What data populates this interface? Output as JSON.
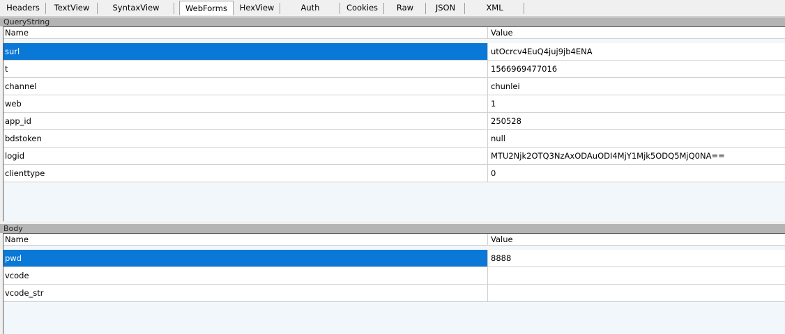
{
  "tabs": [
    {
      "label": "Headers",
      "selected": false
    },
    {
      "label": "TextView",
      "selected": false
    },
    {
      "label": "SyntaxView",
      "selected": false
    },
    {
      "label": "WebForms",
      "selected": true
    },
    {
      "label": "HexView",
      "selected": false
    },
    {
      "label": "Auth",
      "selected": false
    },
    {
      "label": "Cookies",
      "selected": false
    },
    {
      "label": "Raw",
      "selected": false
    },
    {
      "label": "JSON",
      "selected": false
    },
    {
      "label": "XML",
      "selected": false
    }
  ],
  "querystring": {
    "title": "QueryString",
    "columns": {
      "name": "Name",
      "value": "Value"
    },
    "rows": [
      {
        "name": "surl",
        "value": "utOcrcv4EuQ4juj9jb4ENA",
        "selected": true
      },
      {
        "name": "t",
        "value": "1566969477016",
        "selected": false
      },
      {
        "name": "channel",
        "value": "chunlei",
        "selected": false
      },
      {
        "name": "web",
        "value": "1",
        "selected": false
      },
      {
        "name": "app_id",
        "value": "250528",
        "selected": false
      },
      {
        "name": "bdstoken",
        "value": "null",
        "selected": false
      },
      {
        "name": "logid",
        "value": "MTU2Njk2OTQ3NzAxODAuODI4MjY1Mjk5ODQ5MjQ0NA==",
        "selected": false
      },
      {
        "name": "clienttype",
        "value": "0",
        "selected": false
      }
    ]
  },
  "body": {
    "title": "Body",
    "columns": {
      "name": "Name",
      "value": "Value"
    },
    "rows": [
      {
        "name": "pwd",
        "value": "8888",
        "selected": true
      },
      {
        "name": "vcode",
        "value": "",
        "selected": false
      },
      {
        "name": "vcode_str",
        "value": "",
        "selected": false
      }
    ]
  },
  "colors": {
    "selection": "#0a78d7",
    "section_header": "#b4b4b4",
    "grid_empty": "#f2f7fb"
  }
}
